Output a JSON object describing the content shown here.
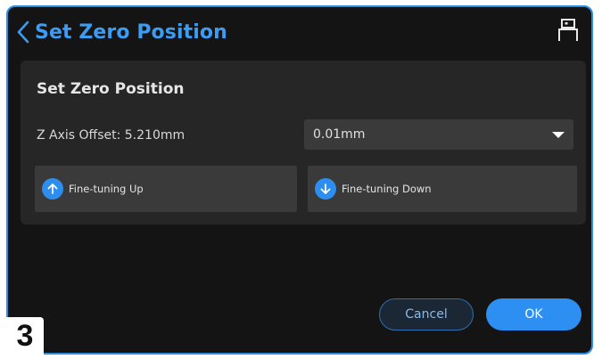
{
  "header": {
    "title": "Set Zero Position",
    "back_icon": "chevron-left-icon",
    "device_icon": "printer-icon"
  },
  "panel": {
    "title": "Set Zero Position",
    "z_offset_label": "Z Axis Offset: 5.210mm",
    "step_select": {
      "selected": "0.01mm"
    },
    "fine_tune_up_label": "Fine-tuning Up",
    "fine_tune_down_label": "Fine-tuning Down"
  },
  "actions": {
    "cancel_label": "Cancel",
    "ok_label": "OK"
  },
  "step_badge": "3",
  "colors": {
    "accent": "#2e8ff2",
    "title_blue": "#3d9bf2",
    "background": "#141414",
    "panel": "#262626",
    "control": "#3a3a3a",
    "frame_border": "#2b8fe6"
  }
}
